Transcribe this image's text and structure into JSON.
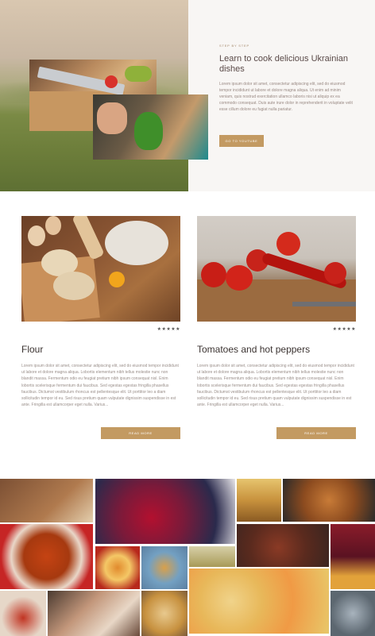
{
  "hero": {
    "eyebrow": "STEP BY STEP",
    "title": "Learn to cook delicious Ukrainian dishes",
    "body": "Lorem ipsum dolor sit amet, consectetur adipiscing elit, sed do eiusmod tempor incididunt ut labore et dolore magna aliqua. Ut enim ad minim veniam, quis nostrud exercitation ullamco laboris nisi ut aliquip ex ea commodo consequat. Duis aute irure dolor in reprehenderit in voluptate velit esse cillum dolore eu fugiat nulla pariatur.",
    "button_label": "GO TO YOUTUBE"
  },
  "cards": [
    {
      "title": "Flour",
      "stars": "★★★★★",
      "body": "Lorem ipsum dolor sit amet, consectetur adipiscing elit, sed do eiusmod tempor incididunt ut labore et dolore magna aliqua. Lobortis elementum nibh tellus molestie nunc non blandit massa. Fermentum odio eu feugiat pretium nibh ipsum consequat nisl. Enim lobortis scelerisque fermentum dui faucibus. Sed egestas egestas fringilla phasellus faucibus. Dictumst vestibulum rhoncus est pellentesque elit. Ut porttitor leo a diam sollicitudin tempor id eu. Sed risus pretium quam vulputate dignissim suspendisse in est ante. Fringilla est ullamcorper eget nulla. Varius...",
      "button_label": "READ MORE"
    },
    {
      "title": "Tomatoes and hot peppers",
      "stars": "★★★★★",
      "body": "Lorem ipsum dolor sit amet, consectetur adipiscing elit, sed do eiusmod tempor incididunt ut labore et dolore magna aliqua. Lobortis elementum nibh tellus molestie nunc non blandit massa. Fermentum odio eu feugiat pretium nibh ipsum consequat nisl. Enim lobortis scelerisque fermentum dui faucibus. Sed egestas egestas fringilla phasellus faucibus. Dictumst vestibulum rhoncus est pellentesque elit. Ut porttitor leo a diam sollicitudin tempor id eu. Sed risus pretium quam vulputate dignissim suspendisse in est ante. Fringilla est ullamcorper eget nulla. Varius...",
      "button_label": "READ MORE"
    }
  ],
  "colors": {
    "accent": "#c39a62",
    "heading": "#3b3331",
    "body_text": "#9a8f8a",
    "hero_bg": "#f8f6f4"
  },
  "icons": {
    "rating": "star-icon"
  }
}
